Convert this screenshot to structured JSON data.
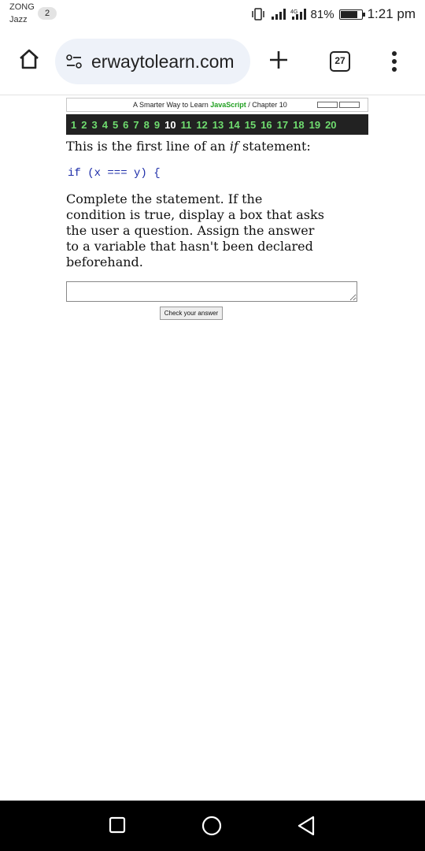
{
  "status_bar": {
    "carrier_1": "ZONG",
    "carrier_2": "Jazz",
    "sim_badge": "2",
    "network": "4G",
    "battery": "81%",
    "battery_level": 0.81,
    "time": "1:21 pm"
  },
  "browser": {
    "url": "erwaytolearn.com",
    "tab_count": "27",
    "icons": {
      "home": "home-icon",
      "site_info": "site-settings-icon",
      "new_tab": "plus-icon",
      "menu": "more-vert-icon"
    }
  },
  "page": {
    "header": {
      "prefix": "A Smarter Way to Learn ",
      "language": "JavaScript",
      "chapter": " / Chapter 10"
    },
    "exercise_numbers": [
      "1",
      "2",
      "3",
      "4",
      "5",
      "6",
      "7",
      "8",
      "9",
      "10",
      "11",
      "12",
      "13",
      "14",
      "15",
      "16",
      "17",
      "18",
      "19",
      "20"
    ],
    "current_exercise": "10",
    "intro_before": "This is the first line of an ",
    "intro_keyword": "if",
    "intro_after": " statement:",
    "code_line": "if (x === y) {",
    "instructions": "Complete the statement. If the condition is true, display a box that asks the user a question. Assign the answer to a variable that hasn't been declared beforehand.",
    "answer_value": "",
    "check_button": "Check your answer"
  },
  "colors": {
    "nav_background": "#222222",
    "exercise_link": "#6fdc6f",
    "current_exercise": "#ffffff",
    "javascript_label": "#1f9f1f",
    "code_text": "#1c2ca8"
  },
  "system_nav": {
    "recents": "square-icon",
    "home": "circle-icon",
    "back": "triangle-back-icon"
  }
}
